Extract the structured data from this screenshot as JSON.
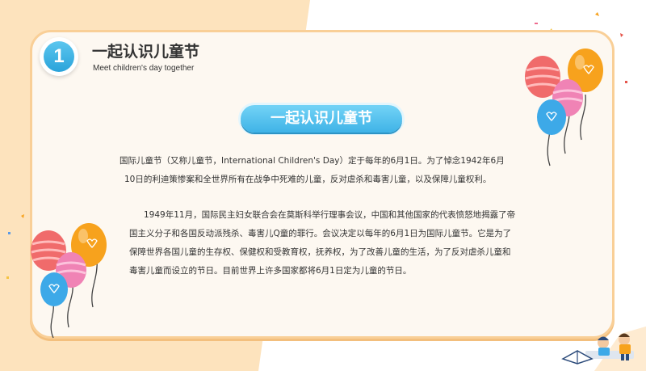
{
  "section": {
    "number": "1",
    "title": "一起认识儿童节",
    "subtitle": "Meet children's day together"
  },
  "pill_title": "一起认识儿童节",
  "paragraph1": {
    "line1": "国际儿童节（又称儿童节，International Children's Day）定于每年的6月1日。为了悼念1942年6月",
    "line2": "10日的利迪策惨案和全世界所有在战争中死难的儿童，反对虐杀和毒害儿童，以及保障儿童权利。"
  },
  "paragraph2": {
    "line1": "1949年11月，国际民主妇女联合会在莫斯科举行理事会议，中国和其他国家的代表愤怒地揭露了帝",
    "line2": "国主义分子和各国反动派残杀、毒害儿Q童的罪行。会议决定以每年的6月1日为国际儿童节。它是为了",
    "line3": "保障世界各国儿童的生存权、保健权和受教育权，抚养权，为了改善儿童的生活，为了反对虐杀儿童和",
    "line4": "毒害儿童而设立的节日。目前世界上许多国家都将6月1日定为儿童的节日。"
  },
  "colors": {
    "accent_blue": "#3fb3e7",
    "card_border": "#f9cf97",
    "peach_bg": "#fde3bd",
    "balloon_red": "#f06b6b",
    "balloon_orange": "#f7a21d",
    "balloon_pink": "#f083b5",
    "balloon_blue": "#3da9e8"
  },
  "icons": {
    "balloon_cluster_top_right": "balloon-cluster-icon",
    "balloon_cluster_bottom_left": "balloon-cluster-icon",
    "kids_reading": "kids-reading-illustration"
  }
}
